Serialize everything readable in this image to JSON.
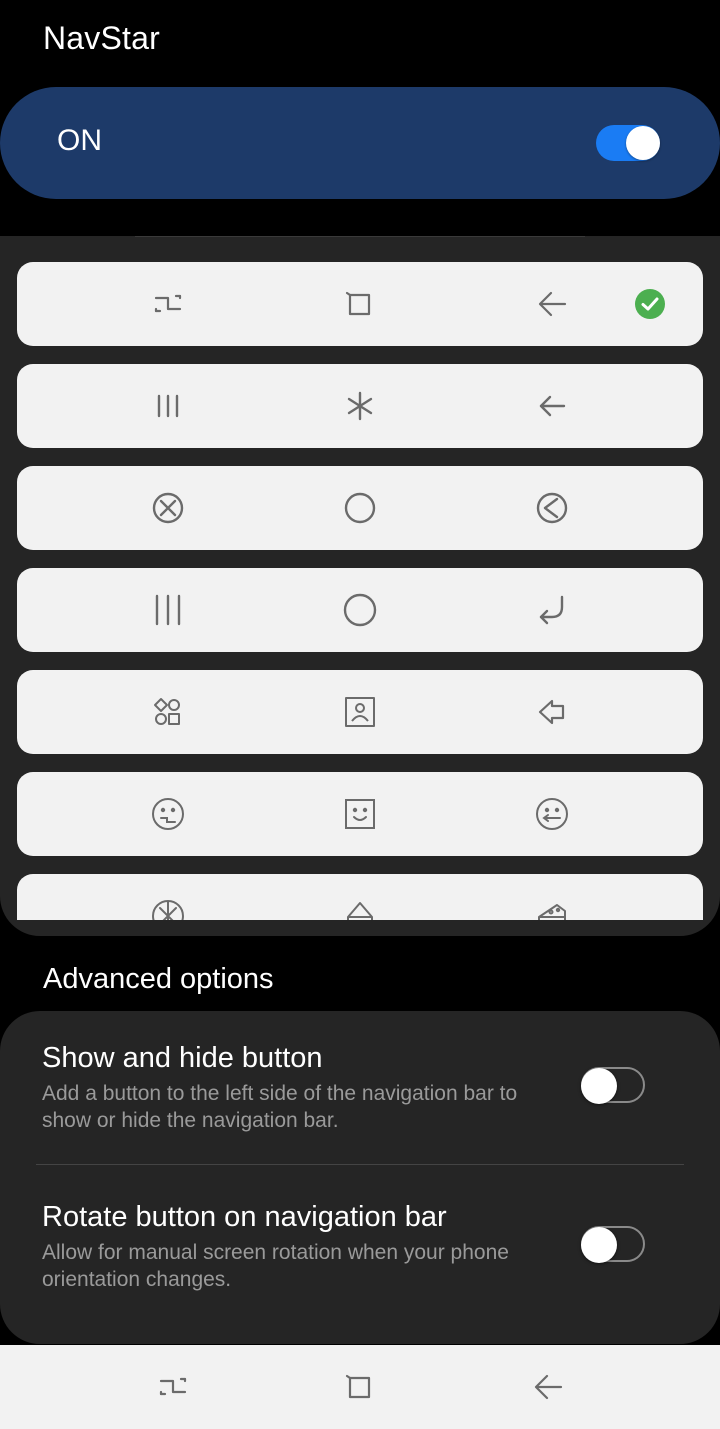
{
  "app": {
    "title": "NavStar"
  },
  "master": {
    "label": "ON",
    "enabled": true
  },
  "styles": [
    {
      "icons": [
        "recent-apps-zigzag-icon",
        "home-square-icon",
        "back-arrow-icon"
      ],
      "selected": true
    },
    {
      "icons": [
        "recent-apps-lines-icon",
        "home-asterisk-icon",
        "back-arrow-icon"
      ],
      "selected": false
    },
    {
      "icons": [
        "recent-apps-circle-x-icon",
        "home-circle-icon",
        "back-circle-arrow-icon"
      ],
      "selected": false
    },
    {
      "icons": [
        "recent-apps-lines-icon",
        "home-circle-icon",
        "back-curved-arrow-icon"
      ],
      "selected": false
    },
    {
      "icons": [
        "recent-apps-shapes-icon",
        "home-portrait-icon",
        "back-pointer-icon"
      ],
      "selected": false
    },
    {
      "icons": [
        "recent-apps-face-icon",
        "home-face-square-icon",
        "back-face-icon"
      ],
      "selected": false
    },
    {
      "icons": [
        "recent-apps-donut-icon",
        "home-cake-icon",
        "back-cheese-icon"
      ],
      "selected": false
    }
  ],
  "advanced": {
    "header": "Advanced options",
    "options": [
      {
        "title": "Show and hide button",
        "description": "Add a button to the left side of the navigation bar to show or hide the navigation bar.",
        "enabled": false
      },
      {
        "title": "Rotate button on navigation bar",
        "description": "Allow for manual screen rotation when your phone orientation changes.",
        "enabled": false
      }
    ]
  },
  "navbar": {
    "icons": [
      "recent-apps-zigzag-icon",
      "home-square-icon",
      "back-arrow-icon"
    ]
  },
  "colors": {
    "accent": "#1a7cf4",
    "master_bg": "#1d3a69",
    "check": "#4caf50",
    "icon_stroke": "#6b6b6b"
  }
}
